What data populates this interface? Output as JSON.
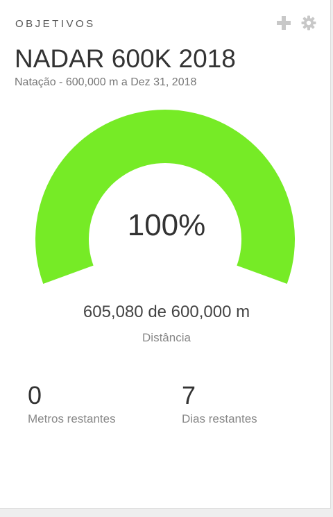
{
  "header": {
    "label": "OBJETIVOS",
    "icons": [
      "add-icon",
      "gear-icon"
    ]
  },
  "goal": {
    "title": "NADAR 600K 2018",
    "subtitle": "Natação - 600,000 m a Dez 31, 2018"
  },
  "gauge": {
    "percent_text": "100%",
    "fill_fraction": 1.0,
    "fill_color": "#76eb26"
  },
  "progress": {
    "text": "605,080 de 600,000 m",
    "metric_label": "Distância"
  },
  "stats": [
    {
      "value": "0",
      "label": "Metros restantes"
    },
    {
      "value": "7",
      "label": "Dias restantes"
    }
  ],
  "colors": {
    "icon_gray": "#c8c8c8"
  }
}
